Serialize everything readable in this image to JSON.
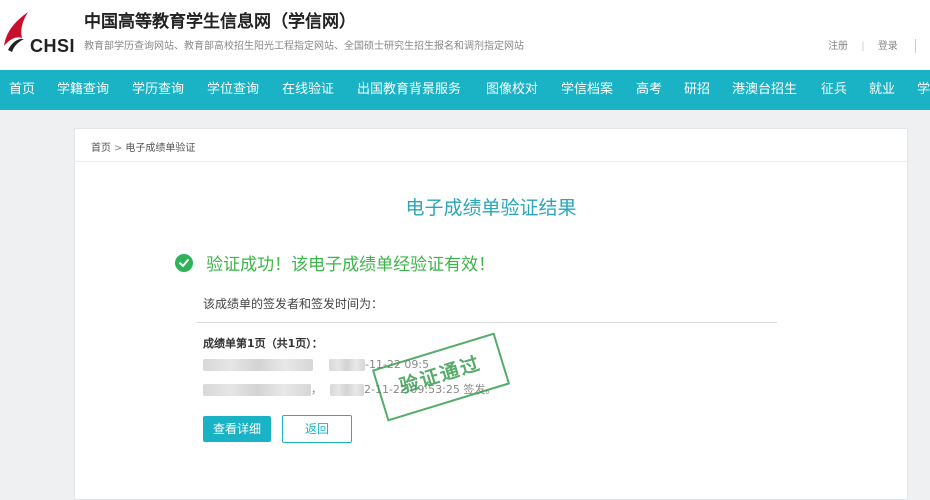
{
  "header": {
    "logo_text": "CHSI",
    "title": "中国高等教育学生信息网（学信网）",
    "subtitle": "教育部学历查询网站、教育部高校招生阳光工程指定网站、全国硕士研究生招生报名和调剂指定网站",
    "links": {
      "register": "注册",
      "login": "登录"
    }
  },
  "nav": {
    "items": [
      "首页",
      "学籍查询",
      "学历查询",
      "学位查询",
      "在线验证",
      "出国教育背景服务",
      "图像校对",
      "学信档案",
      "高考",
      "研招",
      "港澳台招生",
      "征兵",
      "就业",
      "学"
    ]
  },
  "breadcrumb": {
    "home": "首页",
    "current": "电子成绩单验证"
  },
  "result": {
    "title": "电子成绩单验证结果",
    "success_message": "验证成功！该电子成绩单经验证有效！",
    "issuer_label": "该成绩单的签发者和签发时间为：",
    "page_label": "成绩单第1页（共1页）：",
    "line1_partial": "-11-22 09:5",
    "line2_mid": "，",
    "line2_partial": "2-11-22 09:53:25 签发。",
    "stamp_text": "验证通过"
  },
  "buttons": {
    "detail": "查看详细",
    "back": "返回"
  },
  "colors": {
    "accent": "#1ab3c6",
    "success": "#3bb54a",
    "title": "#2aa6b8"
  }
}
